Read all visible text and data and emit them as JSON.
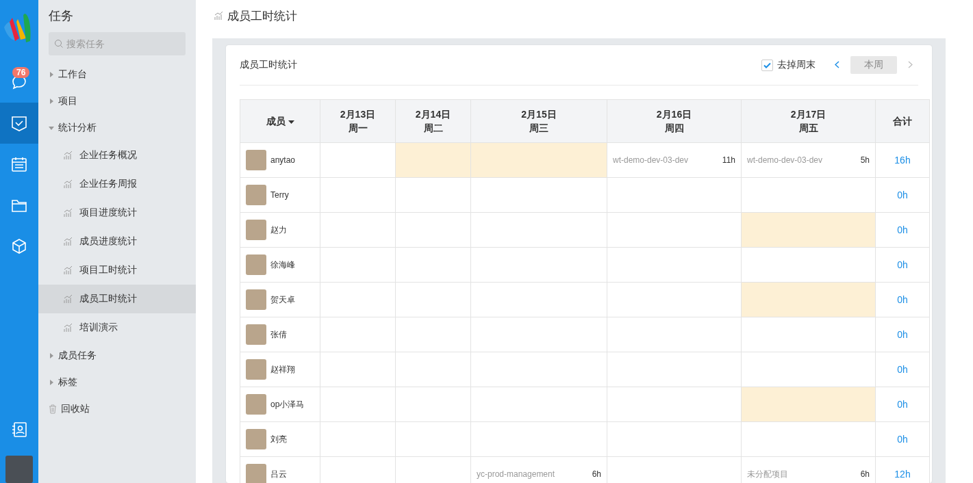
{
  "rail": {
    "badge": "76",
    "items": [
      {
        "kind": "chat",
        "selected": false
      },
      {
        "kind": "tasks",
        "selected": true
      },
      {
        "kind": "calendar",
        "selected": false
      },
      {
        "kind": "folder",
        "selected": false
      },
      {
        "kind": "cube",
        "selected": false
      }
    ]
  },
  "sidebar": {
    "title": "任务",
    "search": {
      "placeholder": "搜索任务"
    },
    "items": [
      {
        "label": "工作台",
        "kind": "group",
        "expanded": false
      },
      {
        "label": "项目",
        "kind": "group",
        "expanded": false
      },
      {
        "label": "统计分析",
        "kind": "group",
        "expanded": true,
        "children": [
          {
            "label": "企业任务概况",
            "selected": false
          },
          {
            "label": "企业任务周报",
            "selected": false
          },
          {
            "label": "项目进度统计",
            "selected": false
          },
          {
            "label": "成员进度统计",
            "selected": false
          },
          {
            "label": "项目工时统计",
            "selected": false
          },
          {
            "label": "成员工时统计",
            "selected": true
          },
          {
            "label": "培训演示",
            "selected": false
          }
        ]
      },
      {
        "label": "成员任务",
        "kind": "group",
        "expanded": false
      },
      {
        "label": "标签",
        "kind": "group",
        "expanded": false
      },
      {
        "label": "回收站",
        "kind": "trash"
      }
    ]
  },
  "page_title": "成员工时统计",
  "card": {
    "title": "成员工时统计",
    "exclude_weekend": {
      "label": "去掉周末",
      "checked": true
    },
    "week_button": "本周",
    "table": {
      "member_column": "成员",
      "day_columns": [
        {
          "date": "2月13日",
          "weekday": "周一"
        },
        {
          "date": "2月14日",
          "weekday": "周二"
        },
        {
          "date": "2月15日",
          "weekday": "周三"
        },
        {
          "date": "2月16日",
          "weekday": "周四"
        },
        {
          "date": "2月17日",
          "weekday": "周五"
        }
      ],
      "total_column": "合计",
      "rows": [
        {
          "name": "anytao",
          "total": "16h",
          "cells": [
            {
              "highlighted": false
            },
            {
              "highlighted": true
            },
            {
              "highlighted": true
            },
            {
              "highlighted": false,
              "project": "wt-demo-dev-03-dev",
              "hours": "11h"
            },
            {
              "highlighted": false,
              "project": "wt-demo-dev-03-dev",
              "hours": "5h"
            }
          ]
        },
        {
          "name": "Terry",
          "total": "0h",
          "cells": [
            {
              "highlighted": false
            },
            {
              "highlighted": false
            },
            {
              "highlighted": false
            },
            {
              "highlighted": false
            },
            {
              "highlighted": false
            }
          ]
        },
        {
          "name": "赵力",
          "total": "0h",
          "cells": [
            {
              "highlighted": false
            },
            {
              "highlighted": false
            },
            {
              "highlighted": false
            },
            {
              "highlighted": false
            },
            {
              "highlighted": true
            }
          ]
        },
        {
          "name": "徐海峰",
          "total": "0h",
          "cells": [
            {
              "highlighted": false
            },
            {
              "highlighted": false
            },
            {
              "highlighted": false
            },
            {
              "highlighted": false
            },
            {
              "highlighted": false
            }
          ]
        },
        {
          "name": "贺天卓",
          "total": "0h",
          "cells": [
            {
              "highlighted": false
            },
            {
              "highlighted": false
            },
            {
              "highlighted": false
            },
            {
              "highlighted": false
            },
            {
              "highlighted": true
            }
          ]
        },
        {
          "name": "张倩",
          "total": "0h",
          "cells": [
            {
              "highlighted": false
            },
            {
              "highlighted": false
            },
            {
              "highlighted": false
            },
            {
              "highlighted": false
            },
            {
              "highlighted": false
            }
          ]
        },
        {
          "name": "赵祥翔",
          "total": "0h",
          "cells": [
            {
              "highlighted": false
            },
            {
              "highlighted": false
            },
            {
              "highlighted": false
            },
            {
              "highlighted": false
            },
            {
              "highlighted": false
            }
          ]
        },
        {
          "name": "op小泽马",
          "total": "0h",
          "cells": [
            {
              "highlighted": false
            },
            {
              "highlighted": false
            },
            {
              "highlighted": false
            },
            {
              "highlighted": false
            },
            {
              "highlighted": true
            }
          ]
        },
        {
          "name": "刘亮",
          "total": "0h",
          "cells": [
            {
              "highlighted": false
            },
            {
              "highlighted": false
            },
            {
              "highlighted": false
            },
            {
              "highlighted": false
            },
            {
              "highlighted": false
            }
          ]
        },
        {
          "name": "吕云",
          "total": "12h",
          "cells": [
            {
              "highlighted": false
            },
            {
              "highlighted": false
            },
            {
              "highlighted": false,
              "project": "yc-prod-management",
              "hours": "6h"
            },
            {
              "highlighted": false
            },
            {
              "highlighted": false,
              "project": "未分配项目",
              "hours": "6h"
            }
          ]
        }
      ]
    }
  }
}
